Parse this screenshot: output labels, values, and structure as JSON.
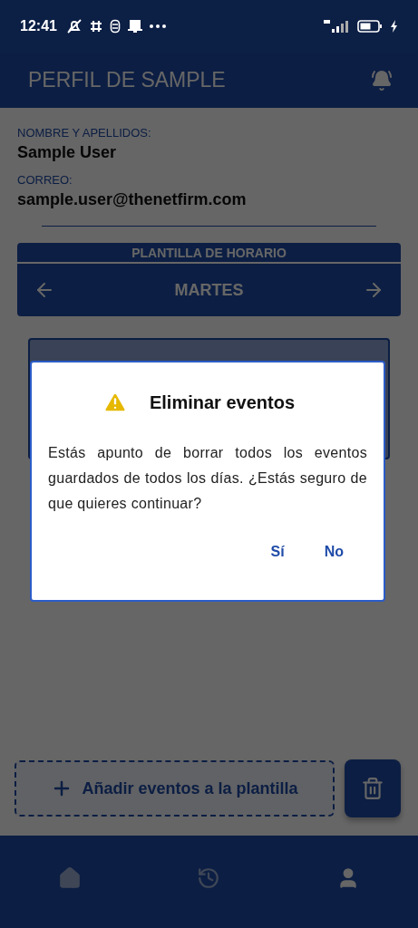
{
  "status_bar": {
    "time": "12:41"
  },
  "header": {
    "title": "PERFIL DE SAMPLE"
  },
  "profile": {
    "fields": [
      {
        "label": "NOMBRE Y APELLIDOS:",
        "value": "Sample User"
      },
      {
        "label": "CORREO:",
        "value": "sample.user@thenetfirm.com"
      }
    ]
  },
  "schedule": {
    "title": "PLANTILLA DE HORARIO",
    "day": "MARTES"
  },
  "add_button": {
    "label": "Añadir eventos a la plantilla"
  },
  "dialog": {
    "title": "Eliminar eventos",
    "message": "Estás apunto de borrar todos los eventos guardados de todos los días. ¿Estás seguro de que quieres continuar?",
    "buttons": [
      "Sí",
      "No"
    ]
  },
  "bottom_nav": [
    {
      "kind": "home",
      "selected": false
    },
    {
      "kind": "history",
      "selected": false
    },
    {
      "kind": "profile",
      "selected": true
    }
  ]
}
